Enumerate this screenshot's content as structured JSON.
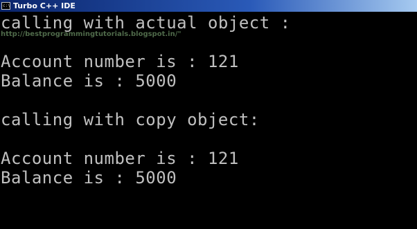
{
  "window": {
    "title": "Turbo C++ IDE",
    "icon": "console-icon"
  },
  "console": {
    "lines": [
      "calling with actual object :",
      "Account number is : 121",
      "Balance is : 5000",
      "calling with copy object:",
      "Account number is : 121",
      "Balance is : 5000"
    ],
    "watermark": "http://bestprogrammingtutorials.blogspot.in/\""
  },
  "colors": {
    "background": "#000000",
    "text": "#c0c0c0",
    "titlebar": "#0a246a",
    "watermark": "#4f6a4a"
  }
}
